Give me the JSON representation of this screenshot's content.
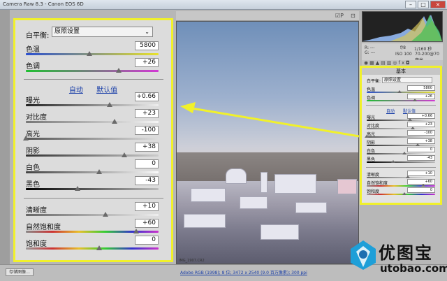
{
  "window": {
    "title": "Camera Raw 8.3 - Canon EOS 6D"
  },
  "left_panel": {
    "white_balance": {
      "label": "白平衡:",
      "value": "原照设置"
    },
    "temp": {
      "label": "色温",
      "value": "5800",
      "level": 0.48
    },
    "tint": {
      "label": "色调",
      "value": "+26",
      "level": 0.7
    },
    "auto_label": "自动",
    "default_label": "默认值",
    "exposure": {
      "label": "曝光",
      "value": "+0.66",
      "level": 0.63
    },
    "contrast": {
      "label": "对比度",
      "value": "+23",
      "level": 0.67
    },
    "highlights": {
      "label": "高光",
      "value": "-100",
      "level": 0.0
    },
    "shadows": {
      "label": "阴影",
      "value": "+38",
      "level": 0.74
    },
    "whites": {
      "label": "白色",
      "value": "0",
      "level": 0.55
    },
    "blacks": {
      "label": "黑色",
      "value": "-43",
      "level": 0.39
    },
    "clarity": {
      "label": "清晰度",
      "value": "+10",
      "level": 0.6
    },
    "vibrance": {
      "label": "自然饱和度",
      "value": "+60",
      "level": 0.83
    },
    "saturation": {
      "label": "饱和度",
      "value": "0",
      "level": 0.55
    }
  },
  "right_panel": {
    "header": "基本",
    "white_balance": {
      "label": "白平衡:",
      "value": "原照设置"
    },
    "temp": {
      "label": "色温",
      "value": "5800",
      "level": 0.48
    },
    "tint": {
      "label": "色调",
      "value": "+26",
      "level": 0.7
    },
    "auto_label": "自动",
    "default_label": "默认值",
    "exposure": {
      "label": "曝光",
      "value": "+0.66",
      "level": 0.63
    },
    "contrast": {
      "label": "对比度",
      "value": "+23",
      "level": 0.67
    },
    "highlights": {
      "label": "高光",
      "value": "-100",
      "level": 0.0
    },
    "shadows": {
      "label": "阴影",
      "value": "+38",
      "level": 0.74
    },
    "whites": {
      "label": "白色",
      "value": "0",
      "level": 0.55
    },
    "blacks": {
      "label": "黑色",
      "value": "-43",
      "level": 0.39
    },
    "clarity": {
      "label": "清晰度",
      "value": "+10",
      "level": 0.6
    },
    "vibrance": {
      "label": "自然饱和度",
      "value": "+60",
      "level": 0.83
    },
    "saturation": {
      "label": "饱和度",
      "value": "0",
      "level": 0.55
    }
  },
  "camera_info": {
    "aperture": "f/8",
    "shutter": "1/160 秒",
    "iso": "ISO 100",
    "lens": "70-200@70 毫米"
  },
  "file_name": "IMG_1907.CR2",
  "status": {
    "save_button": "存储图像...",
    "workflow_link": "Adobe RGB (1998); 8 位; 3472 x 2540 (9.0 百万像素); 300 ppi"
  },
  "watermark": {
    "cn": "优图宝",
    "en": "utobao.com"
  },
  "colors": {
    "highlight_border": "#f1f12a",
    "link": "#1a3fa8",
    "arrow": "#f1f12a"
  }
}
